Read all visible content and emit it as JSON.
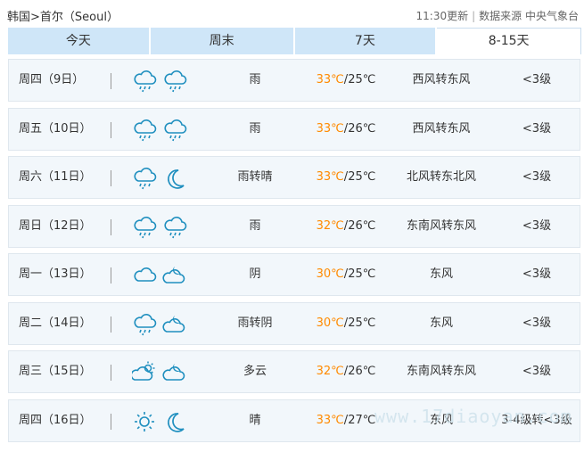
{
  "header": {
    "breadcrumb": "韩国>首尔（Seoul）",
    "update_time": "11:30更新",
    "source": "数据来源 中央气象台"
  },
  "tabs": [
    {
      "label": "今天",
      "active": false
    },
    {
      "label": "周末",
      "active": false
    },
    {
      "label": "7天",
      "active": false
    },
    {
      "label": "8-15天",
      "active": true
    }
  ],
  "forecast": [
    {
      "day": "周四（9日）",
      "icons": [
        "rain-cloud-icon",
        "rain-cloud-icon"
      ],
      "weather": "雨",
      "high": "33℃",
      "low": "25℃",
      "wind": "西风转东风",
      "level": "<3级"
    },
    {
      "day": "周五（10日）",
      "icons": [
        "rain-cloud-icon",
        "rain-cloud-icon"
      ],
      "weather": "雨",
      "high": "33℃",
      "low": "26℃",
      "wind": "西风转东风",
      "level": "<3级"
    },
    {
      "day": "周六（11日）",
      "icons": [
        "rain-cloud-icon",
        "moon-icon"
      ],
      "weather": "雨转晴",
      "high": "33℃",
      "low": "25℃",
      "wind": "北风转东北风",
      "level": "<3级"
    },
    {
      "day": "周日（12日）",
      "icons": [
        "rain-cloud-icon",
        "rain-cloud-icon"
      ],
      "weather": "雨",
      "high": "32℃",
      "low": "26℃",
      "wind": "东南风转东风",
      "level": "<3级"
    },
    {
      "day": "周一（13日）",
      "icons": [
        "overcast-cloud-icon",
        "cloudy-night-icon"
      ],
      "weather": "阴",
      "high": "30℃",
      "low": "25℃",
      "wind": "东风",
      "level": "<3级"
    },
    {
      "day": "周二（14日）",
      "icons": [
        "rain-cloud-icon",
        "cloudy-night-icon"
      ],
      "weather": "雨转阴",
      "high": "30℃",
      "low": "25℃",
      "wind": "东风",
      "level": "<3级"
    },
    {
      "day": "周三（15日）",
      "icons": [
        "partly-cloudy-icon",
        "cloudy-night-icon"
      ],
      "weather": "多云",
      "high": "32℃",
      "low": "26℃",
      "wind": "东南风转东风",
      "level": "<3级"
    },
    {
      "day": "周四（16日）",
      "icons": [
        "sun-icon",
        "moon-icon"
      ],
      "weather": "晴",
      "high": "33℃",
      "low": "27℃",
      "wind": "东风",
      "level": "3-4级转<3级"
    }
  ],
  "watermark": "www.17diaoyan.com",
  "colors": {
    "accent_tab": "#cfe6f8",
    "temp_high": "#ff8a00",
    "row_bg": "#f2f7fb",
    "icon_stroke": "#1f8fbf"
  }
}
